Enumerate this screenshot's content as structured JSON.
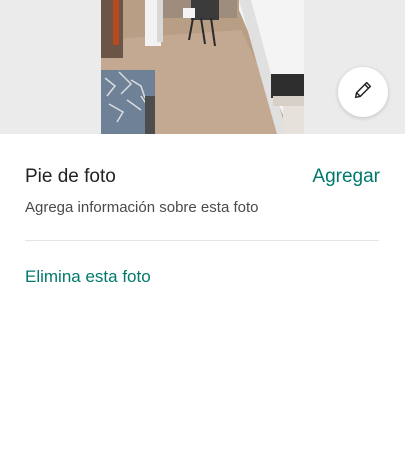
{
  "photo": {
    "image_description_icon": "bedroom-photo",
    "edit_icon": "pencil-icon"
  },
  "caption": {
    "title": "Pie de foto",
    "add_label": "Agregar",
    "description": "Agrega información sobre esta foto"
  },
  "actions": {
    "delete_label": "Elimina esta foto"
  },
  "colors": {
    "accent": "#00796b",
    "text": "#222222",
    "muted": "#4a4a4a",
    "photo_background": "#ebebeb"
  }
}
